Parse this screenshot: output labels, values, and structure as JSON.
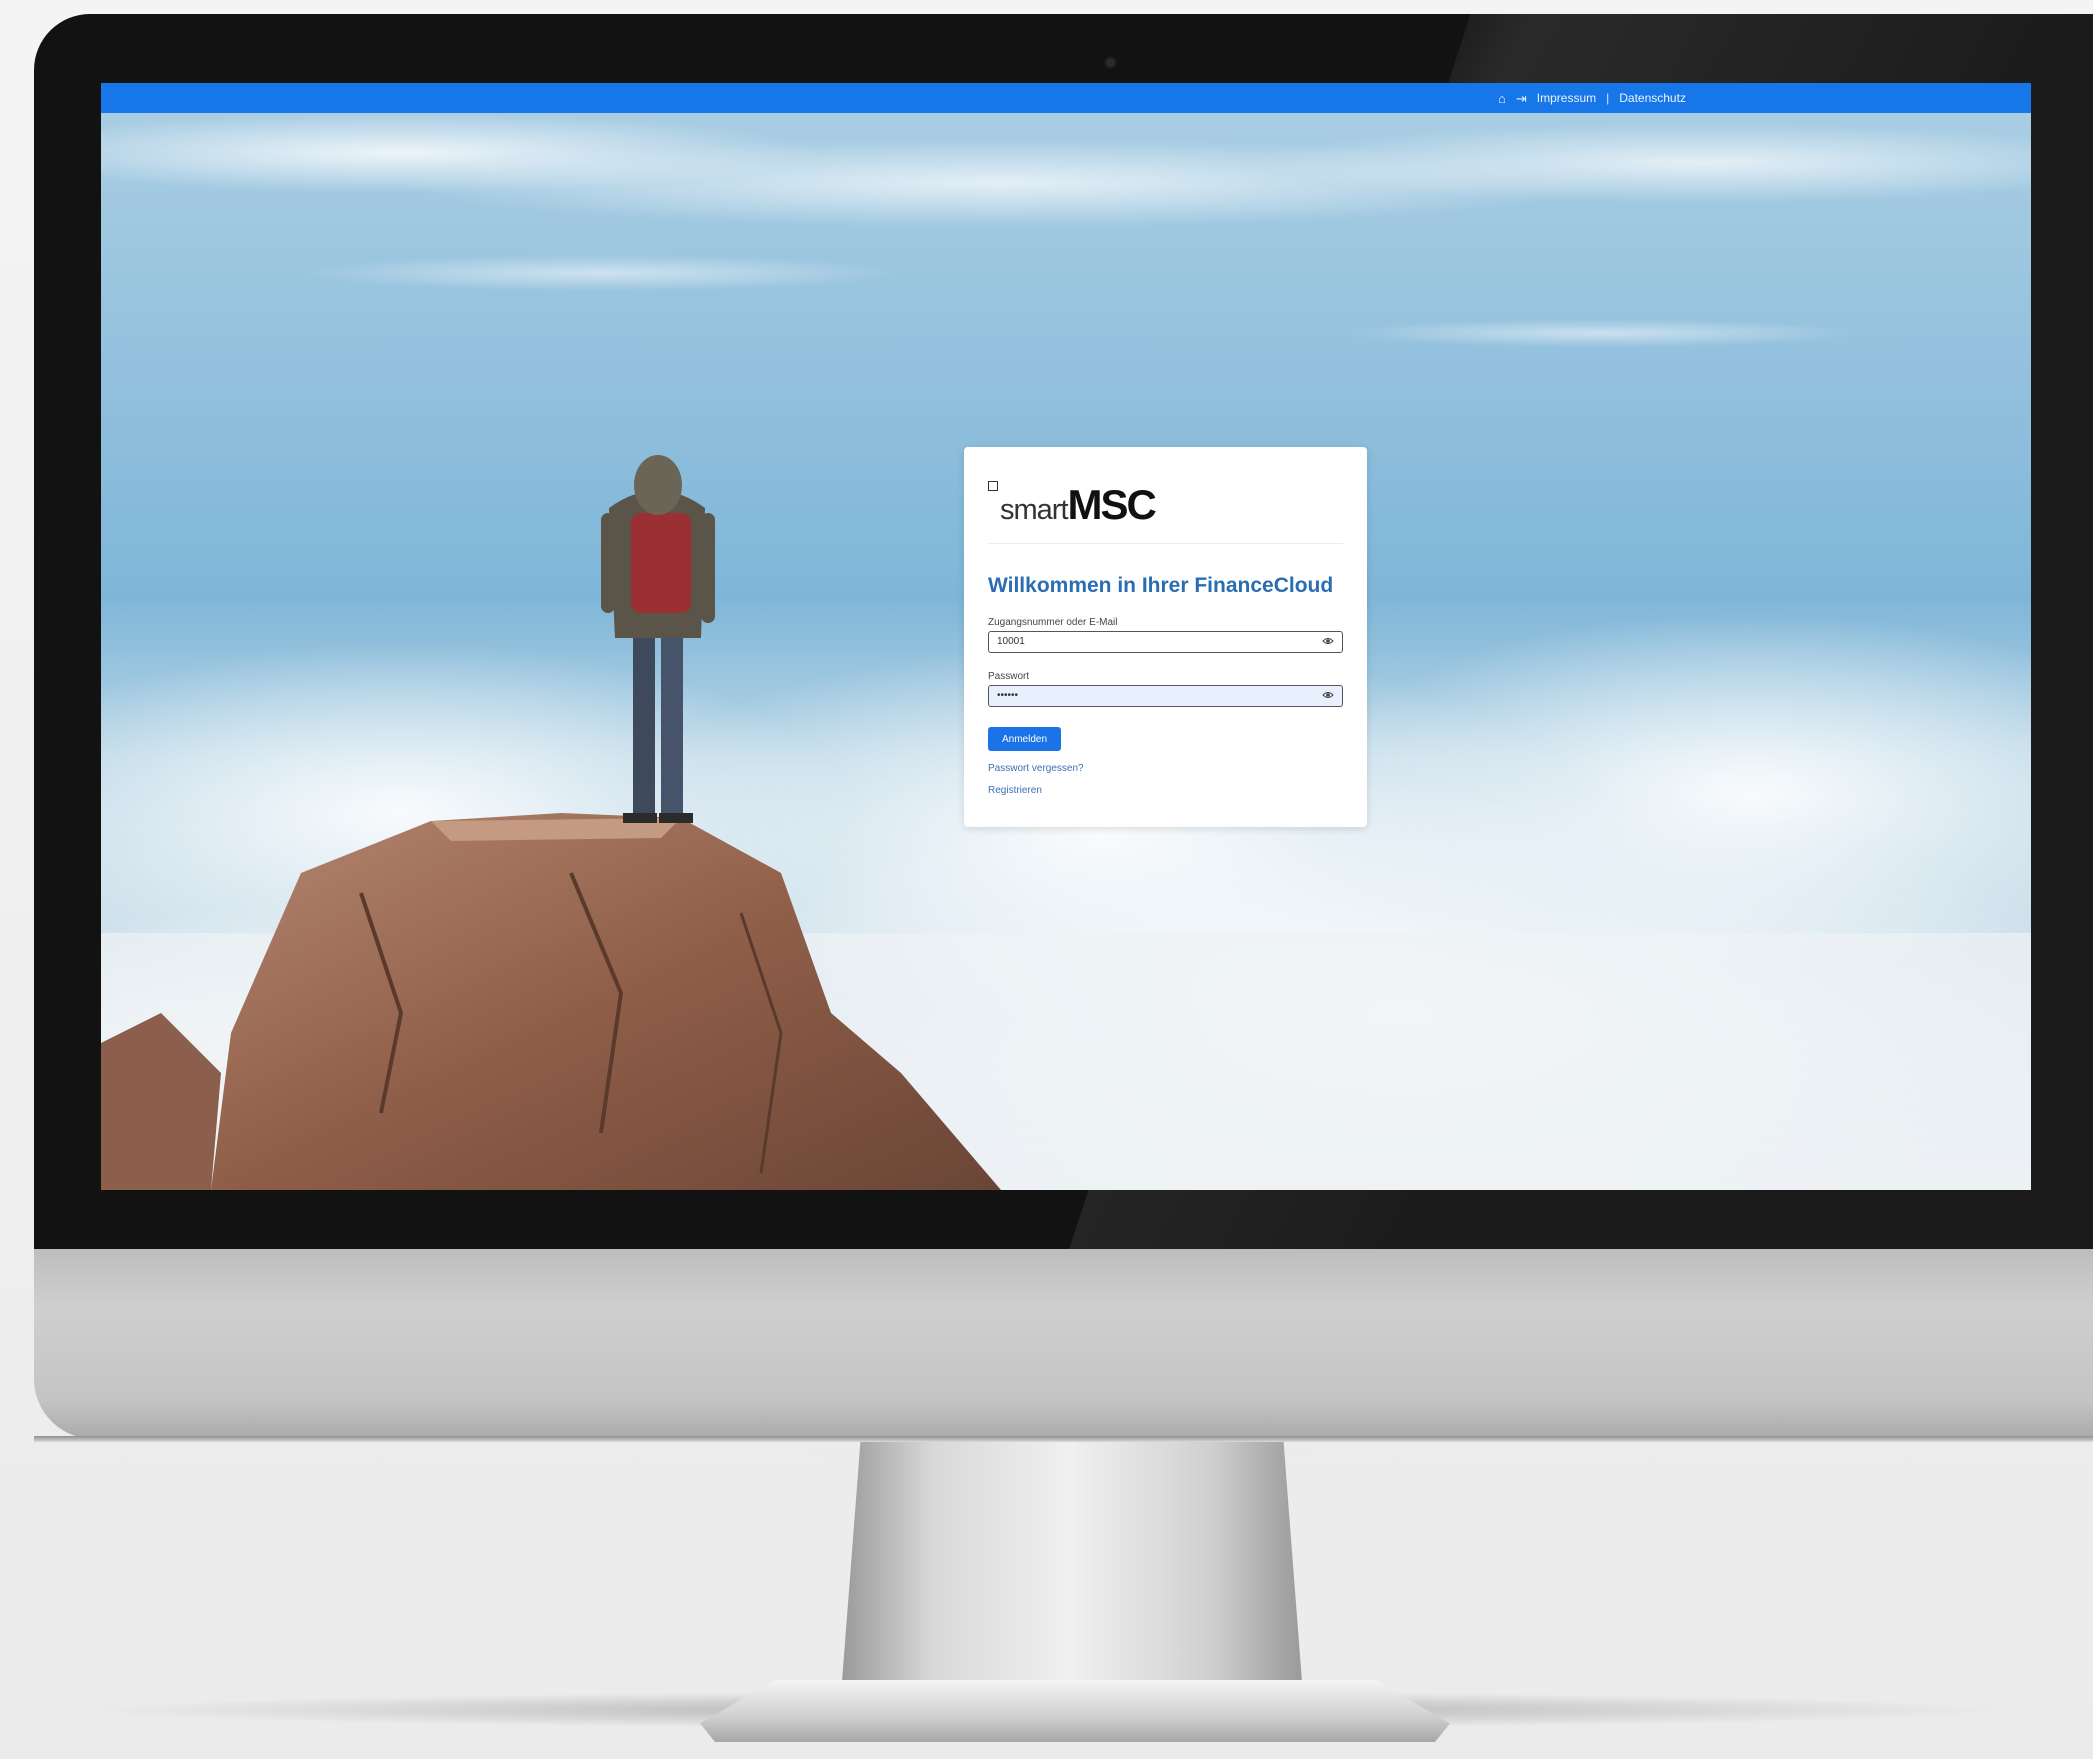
{
  "topbar": {
    "home_icon": "home-icon",
    "login_icon": "login-icon",
    "impressum": "Impressum",
    "separator": "|",
    "datenschutz": "Datenschutz"
  },
  "login": {
    "logo_smart": "smart",
    "logo_msc": "MSC",
    "title": "Willkommen in Ihrer FinanceCloud",
    "username_label": "Zugangsnummer oder E-Mail",
    "username_value": "10001",
    "password_label": "Passwort",
    "password_value": "••••••",
    "eye_icon": "eye-icon",
    "submit_label": "Anmelden",
    "forgot_link": "Passwort vergessen?",
    "register_link": "Registrieren"
  },
  "colors": {
    "topbar": "#1877e8",
    "title": "#2a6db2",
    "button": "#1a73e8",
    "link": "#3b70b8",
    "password_autofill": "#e8f0fe"
  }
}
